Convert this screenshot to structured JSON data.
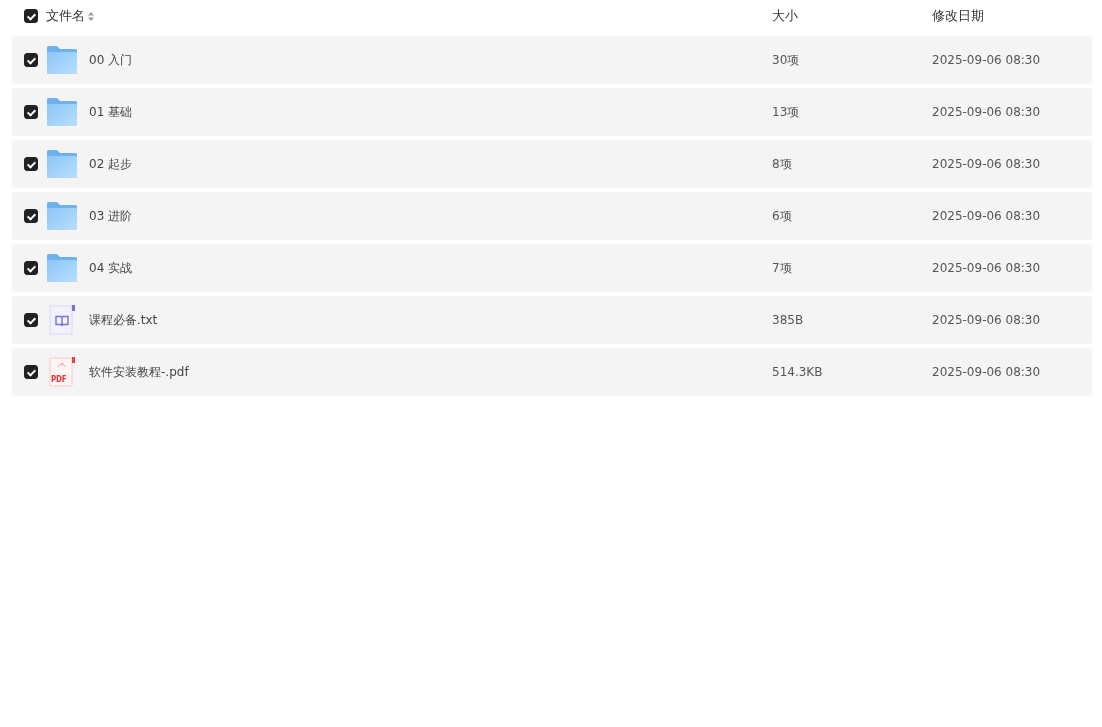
{
  "header": {
    "checked": true,
    "columns": [
      "文件名",
      "大小",
      "修改日期"
    ]
  },
  "files": [
    {
      "kind": "folder",
      "name": "00 入门",
      "size": "30项",
      "modified": "2025-09-06 08:30",
      "checked": true
    },
    {
      "kind": "folder",
      "name": "01 基础",
      "size": "13项",
      "modified": "2025-09-06 08:30",
      "checked": true
    },
    {
      "kind": "folder",
      "name": "02 起步",
      "size": "8项",
      "modified": "2025-09-06 08:30",
      "checked": true
    },
    {
      "kind": "folder",
      "name": "03 进阶",
      "size": "6项",
      "modified": "2025-09-06 08:30",
      "checked": true
    },
    {
      "kind": "folder",
      "name": "04 实战",
      "size": "7项",
      "modified": "2025-09-06 08:30",
      "checked": true
    },
    {
      "kind": "txt",
      "name": "课程必备.txt",
      "size": "385B",
      "modified": "2025-09-06 08:30",
      "checked": true
    },
    {
      "kind": "pdf",
      "icon_label": "PDF",
      "name": "软件安装教程-.pdf",
      "size": "514.3KB",
      "modified": "2025-09-06 08:30",
      "checked": true
    }
  ]
}
